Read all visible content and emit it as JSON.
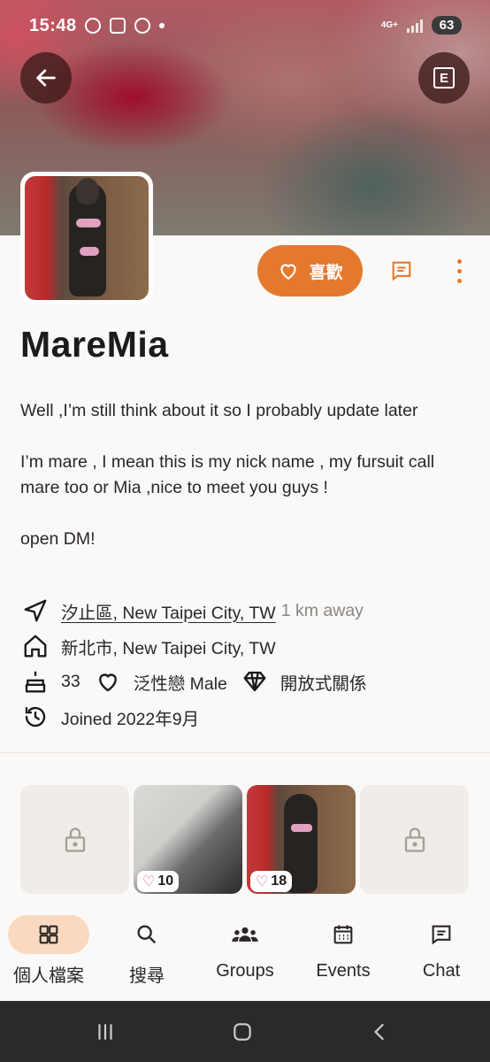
{
  "status_bar": {
    "time": "15:48",
    "network": "4G+",
    "battery": "63"
  },
  "header": {
    "back_icon": "arrow-left-icon",
    "e_label": "E"
  },
  "actions": {
    "like_label": "喜歡",
    "message_icon": "message-icon",
    "more_icon": "more-vertical-icon"
  },
  "profile": {
    "name": "MareMia",
    "bio": [
      "Well ,I’m still think about it so I probably update later",
      "I’m mare , I mean this is my nick name , my fursuit call mare too or Mia ,nice to meet you guys !",
      "open DM!"
    ],
    "location": "汐止區, New Taipei City, TW",
    "distance": "1 km away",
    "hometown": "新北市, New Taipei City, TW",
    "age": "33",
    "orientation": "泛性戀 Male",
    "relationship": "開放式關係",
    "joined": "Joined 2022年9月"
  },
  "gallery": [
    {
      "type": "locked"
    },
    {
      "type": "photo",
      "likes": "10"
    },
    {
      "type": "photo",
      "likes": "18"
    },
    {
      "type": "locked"
    }
  ],
  "bottom_nav": [
    {
      "label": "個人檔案",
      "icon": "grid-icon",
      "active": true
    },
    {
      "label": "搜尋",
      "icon": "search-icon",
      "active": false
    },
    {
      "label": "Groups",
      "icon": "groups-icon",
      "active": false
    },
    {
      "label": "Events",
      "icon": "calendar-icon",
      "active": false
    },
    {
      "label": "Chat",
      "icon": "chat-icon",
      "active": false
    }
  ],
  "colors": {
    "accent": "#e4792d",
    "nav_active_bg": "#fad9c0",
    "text": "#1d1b1a",
    "muted": "#8a8683"
  }
}
